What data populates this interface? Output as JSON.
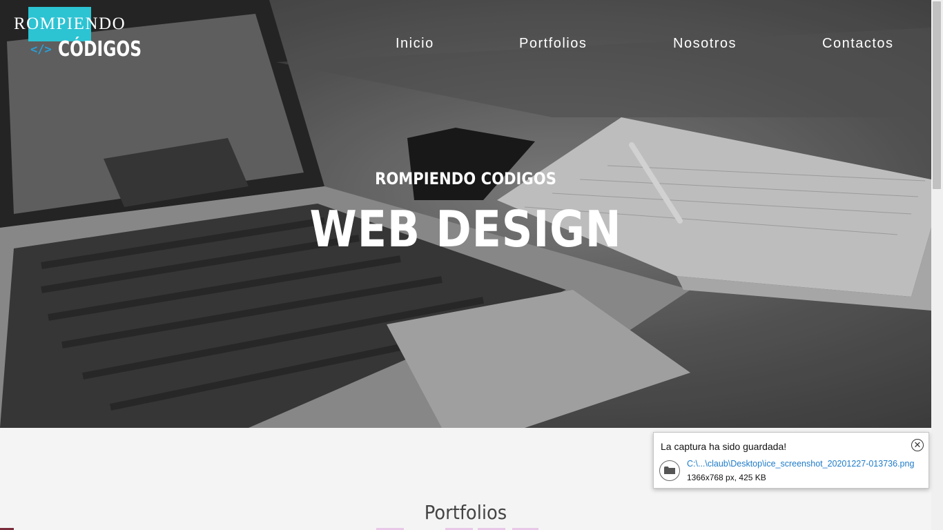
{
  "logo": {
    "word_top": "ROMPIENDO",
    "tag": "</>",
    "word_bottom": "CÓDIGOS",
    "accent_color": "#2cc3d3"
  },
  "nav": {
    "items": [
      {
        "label": "Inicio"
      },
      {
        "label": "Portfolios"
      },
      {
        "label": "Nosotros"
      },
      {
        "label": "Contactos"
      }
    ]
  },
  "hero": {
    "subtitle": "ROMPIENDO CODIGOS",
    "title": "WEB DESIGN"
  },
  "section": {
    "title": "Portfolios"
  },
  "notification": {
    "message": "La captura ha sido guardada!",
    "path": "C:\\...\\claub\\Desktop\\ice_screenshot_20201227-013736.png",
    "meta": "1366x768 px, 425 KB",
    "close_icon": "close-circle-icon",
    "folder_icon": "folder-icon"
  }
}
